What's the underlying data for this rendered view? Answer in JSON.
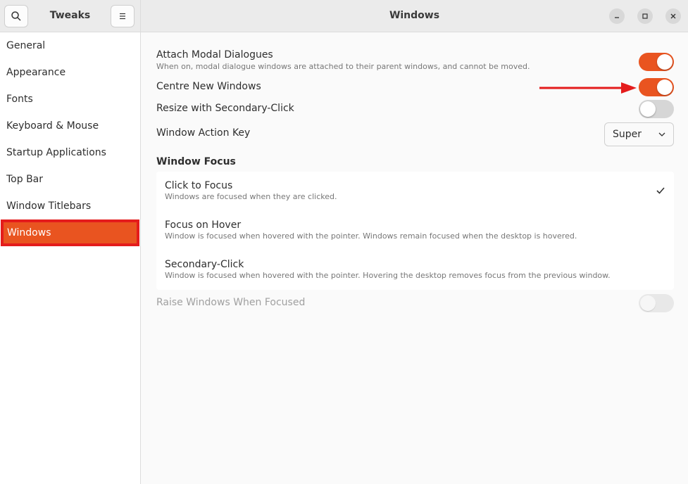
{
  "sidebar": {
    "title": "Tweaks",
    "items": [
      {
        "label": "General"
      },
      {
        "label": "Appearance"
      },
      {
        "label": "Fonts"
      },
      {
        "label": "Keyboard & Mouse"
      },
      {
        "label": "Startup Applications"
      },
      {
        "label": "Top Bar"
      },
      {
        "label": "Window Titlebars"
      },
      {
        "label": "Windows",
        "active": true
      }
    ]
  },
  "header": {
    "title": "Windows"
  },
  "settings": {
    "attach_modal": {
      "label": "Attach Modal Dialogues",
      "sub": "When on, modal dialogue windows are attached to their parent windows, and cannot be moved.",
      "on": true
    },
    "centre_new": {
      "label": "Centre New Windows",
      "on": true
    },
    "resize_secondary": {
      "label": "Resize with Secondary-Click",
      "on": false
    },
    "action_key": {
      "label": "Window Action Key",
      "value": "Super"
    },
    "focus_section": {
      "title": "Window Focus"
    },
    "focus_options": [
      {
        "label": "Click to Focus",
        "sub": "Windows are focused when they are clicked.",
        "selected": true
      },
      {
        "label": "Focus on Hover",
        "sub": "Window is focused when hovered with the pointer. Windows remain focused when the desktop is hovered.",
        "selected": false
      },
      {
        "label": "Secondary-Click",
        "sub": "Window is focused when hovered with the pointer. Hovering the desktop removes focus from the previous window.",
        "selected": false
      }
    ],
    "raise_windows": {
      "label": "Raise Windows When Focused",
      "on": false,
      "disabled": true
    }
  },
  "icons": {
    "search": "search-icon",
    "menu": "hamburger-menu-icon",
    "minimize": "minimize-icon",
    "maximize": "maximize-icon",
    "close": "close-icon",
    "check": "checkmark-icon",
    "chevron": "chevron-down-icon",
    "annotation": "red-arrow-icon"
  },
  "colors": {
    "accent": "#e95420",
    "highlight_border": "#e41c1c"
  }
}
